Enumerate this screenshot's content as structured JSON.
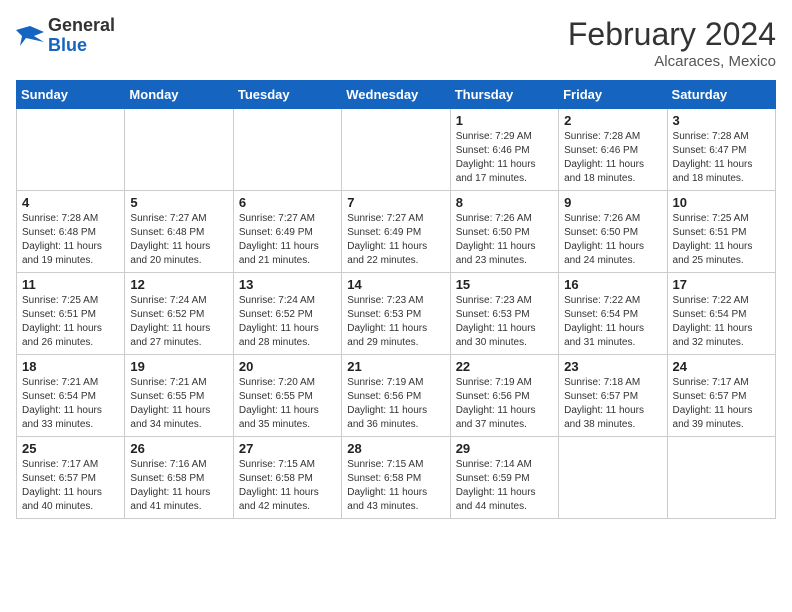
{
  "header": {
    "logo_general": "General",
    "logo_blue": "Blue",
    "month_title": "February 2024",
    "location": "Alcaraces, Mexico"
  },
  "days_of_week": [
    "Sunday",
    "Monday",
    "Tuesday",
    "Wednesday",
    "Thursday",
    "Friday",
    "Saturday"
  ],
  "weeks": [
    [
      {
        "day": "",
        "info": ""
      },
      {
        "day": "",
        "info": ""
      },
      {
        "day": "",
        "info": ""
      },
      {
        "day": "",
        "info": ""
      },
      {
        "day": "1",
        "info": "Sunrise: 7:29 AM\nSunset: 6:46 PM\nDaylight: 11 hours and 17 minutes."
      },
      {
        "day": "2",
        "info": "Sunrise: 7:28 AM\nSunset: 6:46 PM\nDaylight: 11 hours and 18 minutes."
      },
      {
        "day": "3",
        "info": "Sunrise: 7:28 AM\nSunset: 6:47 PM\nDaylight: 11 hours and 18 minutes."
      }
    ],
    [
      {
        "day": "4",
        "info": "Sunrise: 7:28 AM\nSunset: 6:48 PM\nDaylight: 11 hours and 19 minutes."
      },
      {
        "day": "5",
        "info": "Sunrise: 7:27 AM\nSunset: 6:48 PM\nDaylight: 11 hours and 20 minutes."
      },
      {
        "day": "6",
        "info": "Sunrise: 7:27 AM\nSunset: 6:49 PM\nDaylight: 11 hours and 21 minutes."
      },
      {
        "day": "7",
        "info": "Sunrise: 7:27 AM\nSunset: 6:49 PM\nDaylight: 11 hours and 22 minutes."
      },
      {
        "day": "8",
        "info": "Sunrise: 7:26 AM\nSunset: 6:50 PM\nDaylight: 11 hours and 23 minutes."
      },
      {
        "day": "9",
        "info": "Sunrise: 7:26 AM\nSunset: 6:50 PM\nDaylight: 11 hours and 24 minutes."
      },
      {
        "day": "10",
        "info": "Sunrise: 7:25 AM\nSunset: 6:51 PM\nDaylight: 11 hours and 25 minutes."
      }
    ],
    [
      {
        "day": "11",
        "info": "Sunrise: 7:25 AM\nSunset: 6:51 PM\nDaylight: 11 hours and 26 minutes."
      },
      {
        "day": "12",
        "info": "Sunrise: 7:24 AM\nSunset: 6:52 PM\nDaylight: 11 hours and 27 minutes."
      },
      {
        "day": "13",
        "info": "Sunrise: 7:24 AM\nSunset: 6:52 PM\nDaylight: 11 hours and 28 minutes."
      },
      {
        "day": "14",
        "info": "Sunrise: 7:23 AM\nSunset: 6:53 PM\nDaylight: 11 hours and 29 minutes."
      },
      {
        "day": "15",
        "info": "Sunrise: 7:23 AM\nSunset: 6:53 PM\nDaylight: 11 hours and 30 minutes."
      },
      {
        "day": "16",
        "info": "Sunrise: 7:22 AM\nSunset: 6:54 PM\nDaylight: 11 hours and 31 minutes."
      },
      {
        "day": "17",
        "info": "Sunrise: 7:22 AM\nSunset: 6:54 PM\nDaylight: 11 hours and 32 minutes."
      }
    ],
    [
      {
        "day": "18",
        "info": "Sunrise: 7:21 AM\nSunset: 6:54 PM\nDaylight: 11 hours and 33 minutes."
      },
      {
        "day": "19",
        "info": "Sunrise: 7:21 AM\nSunset: 6:55 PM\nDaylight: 11 hours and 34 minutes."
      },
      {
        "day": "20",
        "info": "Sunrise: 7:20 AM\nSunset: 6:55 PM\nDaylight: 11 hours and 35 minutes."
      },
      {
        "day": "21",
        "info": "Sunrise: 7:19 AM\nSunset: 6:56 PM\nDaylight: 11 hours and 36 minutes."
      },
      {
        "day": "22",
        "info": "Sunrise: 7:19 AM\nSunset: 6:56 PM\nDaylight: 11 hours and 37 minutes."
      },
      {
        "day": "23",
        "info": "Sunrise: 7:18 AM\nSunset: 6:57 PM\nDaylight: 11 hours and 38 minutes."
      },
      {
        "day": "24",
        "info": "Sunrise: 7:17 AM\nSunset: 6:57 PM\nDaylight: 11 hours and 39 minutes."
      }
    ],
    [
      {
        "day": "25",
        "info": "Sunrise: 7:17 AM\nSunset: 6:57 PM\nDaylight: 11 hours and 40 minutes."
      },
      {
        "day": "26",
        "info": "Sunrise: 7:16 AM\nSunset: 6:58 PM\nDaylight: 11 hours and 41 minutes."
      },
      {
        "day": "27",
        "info": "Sunrise: 7:15 AM\nSunset: 6:58 PM\nDaylight: 11 hours and 42 minutes."
      },
      {
        "day": "28",
        "info": "Sunrise: 7:15 AM\nSunset: 6:58 PM\nDaylight: 11 hours and 43 minutes."
      },
      {
        "day": "29",
        "info": "Sunrise: 7:14 AM\nSunset: 6:59 PM\nDaylight: 11 hours and 44 minutes."
      },
      {
        "day": "",
        "info": ""
      },
      {
        "day": "",
        "info": ""
      }
    ]
  ]
}
